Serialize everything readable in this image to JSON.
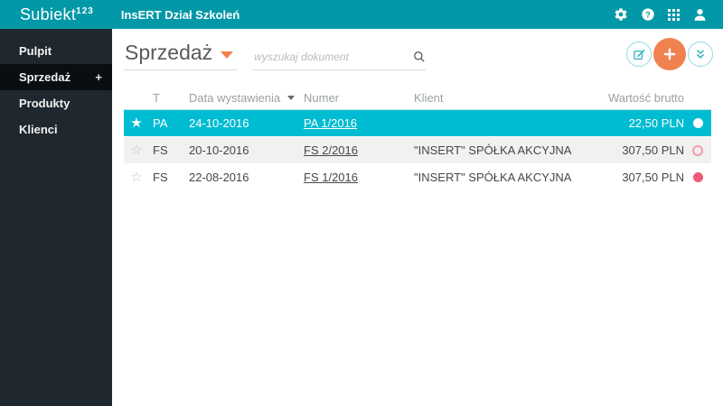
{
  "topbar": {
    "logo": "Subiekt",
    "logo_sup": "123",
    "org": "InsERT Dział Szkoleń",
    "icons": [
      "settings-icon",
      "help-icon",
      "apps-grid-icon",
      "user-icon"
    ]
  },
  "sidebar": {
    "items": [
      {
        "label": "Pulpit",
        "active": false
      },
      {
        "label": "Sprzedaż",
        "active": true,
        "suffix": "+"
      },
      {
        "label": "Produkty",
        "active": false
      },
      {
        "label": "Klienci",
        "active": false
      }
    ]
  },
  "header": {
    "title": "Sprzedaż",
    "search_placeholder": "wyszukaj dokument"
  },
  "table": {
    "columns": {
      "type": "T",
      "date": "Data wystawienia",
      "numer": "Numer",
      "klient": "Klient",
      "amount": "Wartość brutto"
    },
    "rows": [
      {
        "starred": true,
        "type": "PA",
        "date": "24-10-2016",
        "numer": "PA 1/2016",
        "klient": "",
        "amount": "22,50 PLN",
        "selected": true,
        "status": "white-filled"
      },
      {
        "starred": false,
        "type": "FS",
        "date": "20-10-2016",
        "numer": "FS 2/2016",
        "klient": "\"INSERT\" SPÓŁKA AKCYJNA",
        "amount": "307,50 PLN",
        "selected": false,
        "status": "outline"
      },
      {
        "starred": false,
        "type": "FS",
        "date": "22-08-2016",
        "numer": "FS 1/2016",
        "klient": "\"INSERT\" SPÓŁKA AKCYJNA",
        "amount": "307,50 PLN",
        "selected": false,
        "status": "filled"
      }
    ]
  },
  "icons": {
    "star_filled": "★",
    "star_outline": "☆"
  },
  "colors": {
    "topbar": "#0298a8",
    "sidebar": "#1f282e",
    "sidebar_active": "#0a0e11",
    "selected_row": "#00bcd2",
    "accent_orange": "#f0824f",
    "status_pink": "#ee5b74",
    "header_divider": "#b9e6ec"
  }
}
